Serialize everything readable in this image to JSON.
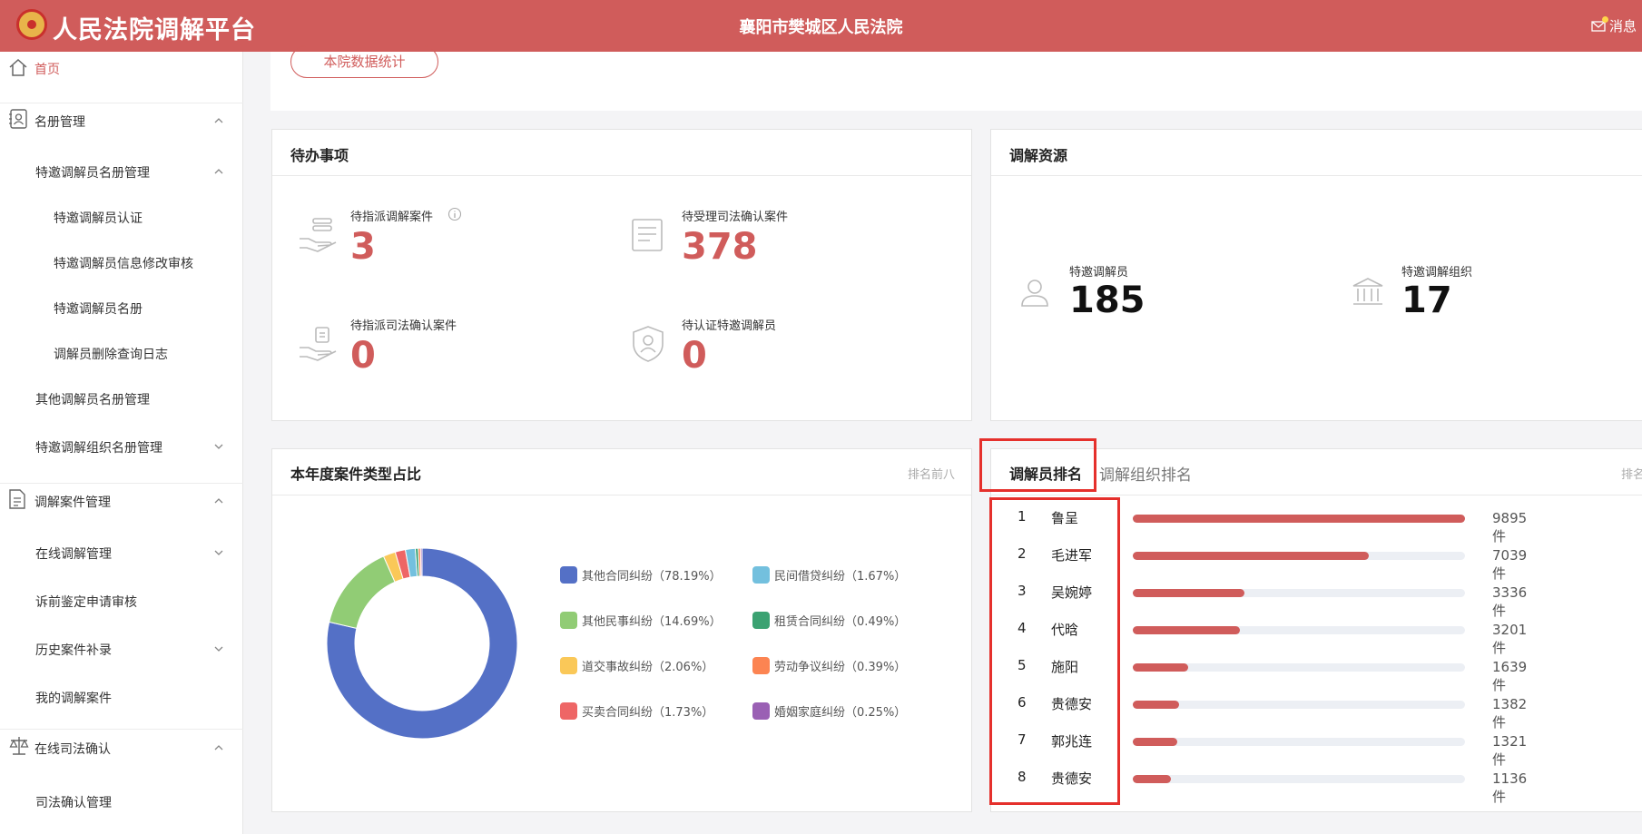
{
  "header": {
    "app_title": "人民法院调解平台",
    "court_name": "襄阳市樊城区人民法院",
    "message_label": "消息"
  },
  "sidebar": {
    "items": [
      {
        "label": "首页",
        "icon": "home-icon",
        "active": true
      },
      {
        "label": "名册管理",
        "icon": "roster-icon",
        "expanded": true
      },
      {
        "label": "特邀调解员名册管理",
        "expanded": true
      },
      {
        "label": "特邀调解员认证"
      },
      {
        "label": "特邀调解员信息修改审核"
      },
      {
        "label": "特邀调解员名册"
      },
      {
        "label": "调解员删除查询日志"
      },
      {
        "label": "其他调解员名册管理"
      },
      {
        "label": "特邀调解组织名册管理",
        "expanded": false
      },
      {
        "label": "调解案件管理",
        "icon": "document-icon",
        "expanded": true
      },
      {
        "label": "在线调解管理",
        "expanded": false
      },
      {
        "label": "诉前鉴定申请审核"
      },
      {
        "label": "历史案件补录",
        "expanded": false
      },
      {
        "label": "我的调解案件"
      },
      {
        "label": "在线司法确认",
        "icon": "scale-icon",
        "expanded": true
      },
      {
        "label": "司法确认管理"
      }
    ]
  },
  "stats_button": "本院数据统计",
  "todo": {
    "title": "待办事项",
    "items": [
      {
        "label": "待指派调解案件",
        "value": "3"
      },
      {
        "label": "待受理司法确认案件",
        "value": "378"
      },
      {
        "label": "待指派司法确认案件",
        "value": "0"
      },
      {
        "label": "待认证特邀调解员",
        "value": "0"
      }
    ]
  },
  "resources": {
    "title": "调解资源",
    "items": [
      {
        "label": "特邀调解员",
        "value": "185"
      },
      {
        "label": "特邀调解组织",
        "value": "17"
      }
    ]
  },
  "case_types": {
    "title": "本年度案件类型占比",
    "hint": "排名前八"
  },
  "chart_data": {
    "type": "pie",
    "donut": true,
    "legend_position": "right",
    "categories": [
      "其他合同纠纷",
      "民间借贷纠纷",
      "其他民事纠纷",
      "租赁合同纠纷",
      "道交事故纠纷",
      "劳动争议纠纷",
      "买卖合同纠纷",
      "婚姻家庭纠纷"
    ],
    "legend_labels": [
      "其他合同纠纷（78.19%）",
      "民间借贷纠纷（1.67%）",
      "其他民事纠纷（14.69%）",
      "租赁合同纠纷（0.49%）",
      "道交事故纠纷（2.06%）",
      "劳动争议纠纷（0.39%）",
      "买卖合同纠纷（1.73%）",
      "婚姻家庭纠纷（0.25%）"
    ],
    "values": [
      78.19,
      1.67,
      14.69,
      0.49,
      2.06,
      0.39,
      1.73,
      0.25
    ],
    "colors": [
      "#5470c6",
      "#73c0de",
      "#91cc75",
      "#3ba272",
      "#fac858",
      "#fc8452",
      "#ee6666",
      "#9a60b4"
    ]
  },
  "ranking": {
    "tab_active": "调解员排名",
    "tab_other": "调解组织排名",
    "hint": "排名",
    "max": 9895,
    "rows": [
      {
        "rank": "1",
        "name": "鲁呈",
        "value": 9895,
        "count": "9895件"
      },
      {
        "rank": "2",
        "name": "毛进军",
        "value": 7039,
        "count": "7039件"
      },
      {
        "rank": "3",
        "name": "吴婉婷",
        "value": 3336,
        "count": "3336件"
      },
      {
        "rank": "4",
        "name": "代晗",
        "value": 3201,
        "count": "3201件"
      },
      {
        "rank": "5",
        "name": "施阳",
        "value": 1639,
        "count": "1639件"
      },
      {
        "rank": "6",
        "name": "贵德安",
        "value": 1382,
        "count": "1382件"
      },
      {
        "rank": "7",
        "name": "郭兆连",
        "value": 1321,
        "count": "1321件"
      },
      {
        "rank": "8",
        "name": "贵德安",
        "value": 1136,
        "count": "1136件"
      }
    ]
  }
}
